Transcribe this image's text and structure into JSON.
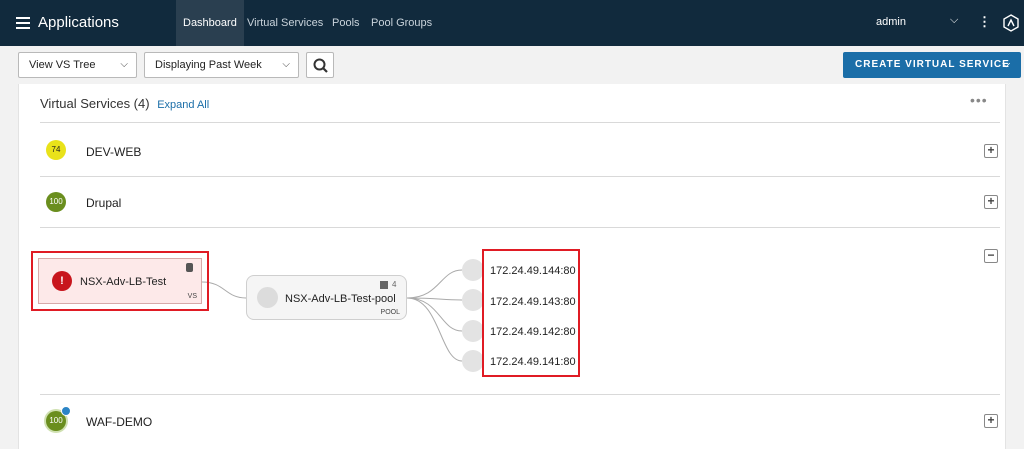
{
  "header": {
    "app_title": "Applications",
    "tabs": [
      {
        "label": "Dashboard",
        "active": true
      },
      {
        "label": "Virtual Services",
        "active": false
      },
      {
        "label": "Pools",
        "active": false
      },
      {
        "label": "Pool Groups",
        "active": false
      }
    ],
    "user": "admin",
    "icons": [
      "menu-icon",
      "chevron-down-icon",
      "kebab-icon",
      "avi-logo-icon"
    ]
  },
  "toolbar": {
    "view_select": "View VS Tree",
    "time_select": "Displaying Past Week",
    "create_label": "CREATE VIRTUAL SERVICE",
    "chevron": "⌵"
  },
  "panel": {
    "title": "Virtual Services (4)",
    "expand_all": "Expand All",
    "more": "•••"
  },
  "virtual_services": [
    {
      "name": "DEV-WEB",
      "score": "74",
      "score_color": "#e9e21a",
      "expanded": false
    },
    {
      "name": "Drupal",
      "score": "100",
      "score_color": "#6a8e1e",
      "expanded": false
    },
    {
      "name": "NSX-Adv-LB-Test",
      "score": "!",
      "score_color": "#c8161d",
      "expanded": true
    },
    {
      "name": "WAF-DEMO",
      "score": "100",
      "score_color": "#6a8e1e",
      "expanded": false
    }
  ],
  "tree": {
    "vs_name": "NSX-Adv-LB-Test",
    "vs_type": "VS",
    "pool_name": "NSX-Adv-LB-Test-pool",
    "pool_type": "POOL",
    "pool_count": "4",
    "servers": [
      "172.24.49.144:80",
      "172.24.49.143:80",
      "172.24.49.142:80",
      "172.24.49.141:80"
    ]
  },
  "controls": {
    "plus": "+",
    "minus": "−"
  },
  "colors": {
    "nav_bg": "#112a3d",
    "accent": "#1b6ea8",
    "alert": "#c8161d",
    "highlight": "#e01b24"
  }
}
